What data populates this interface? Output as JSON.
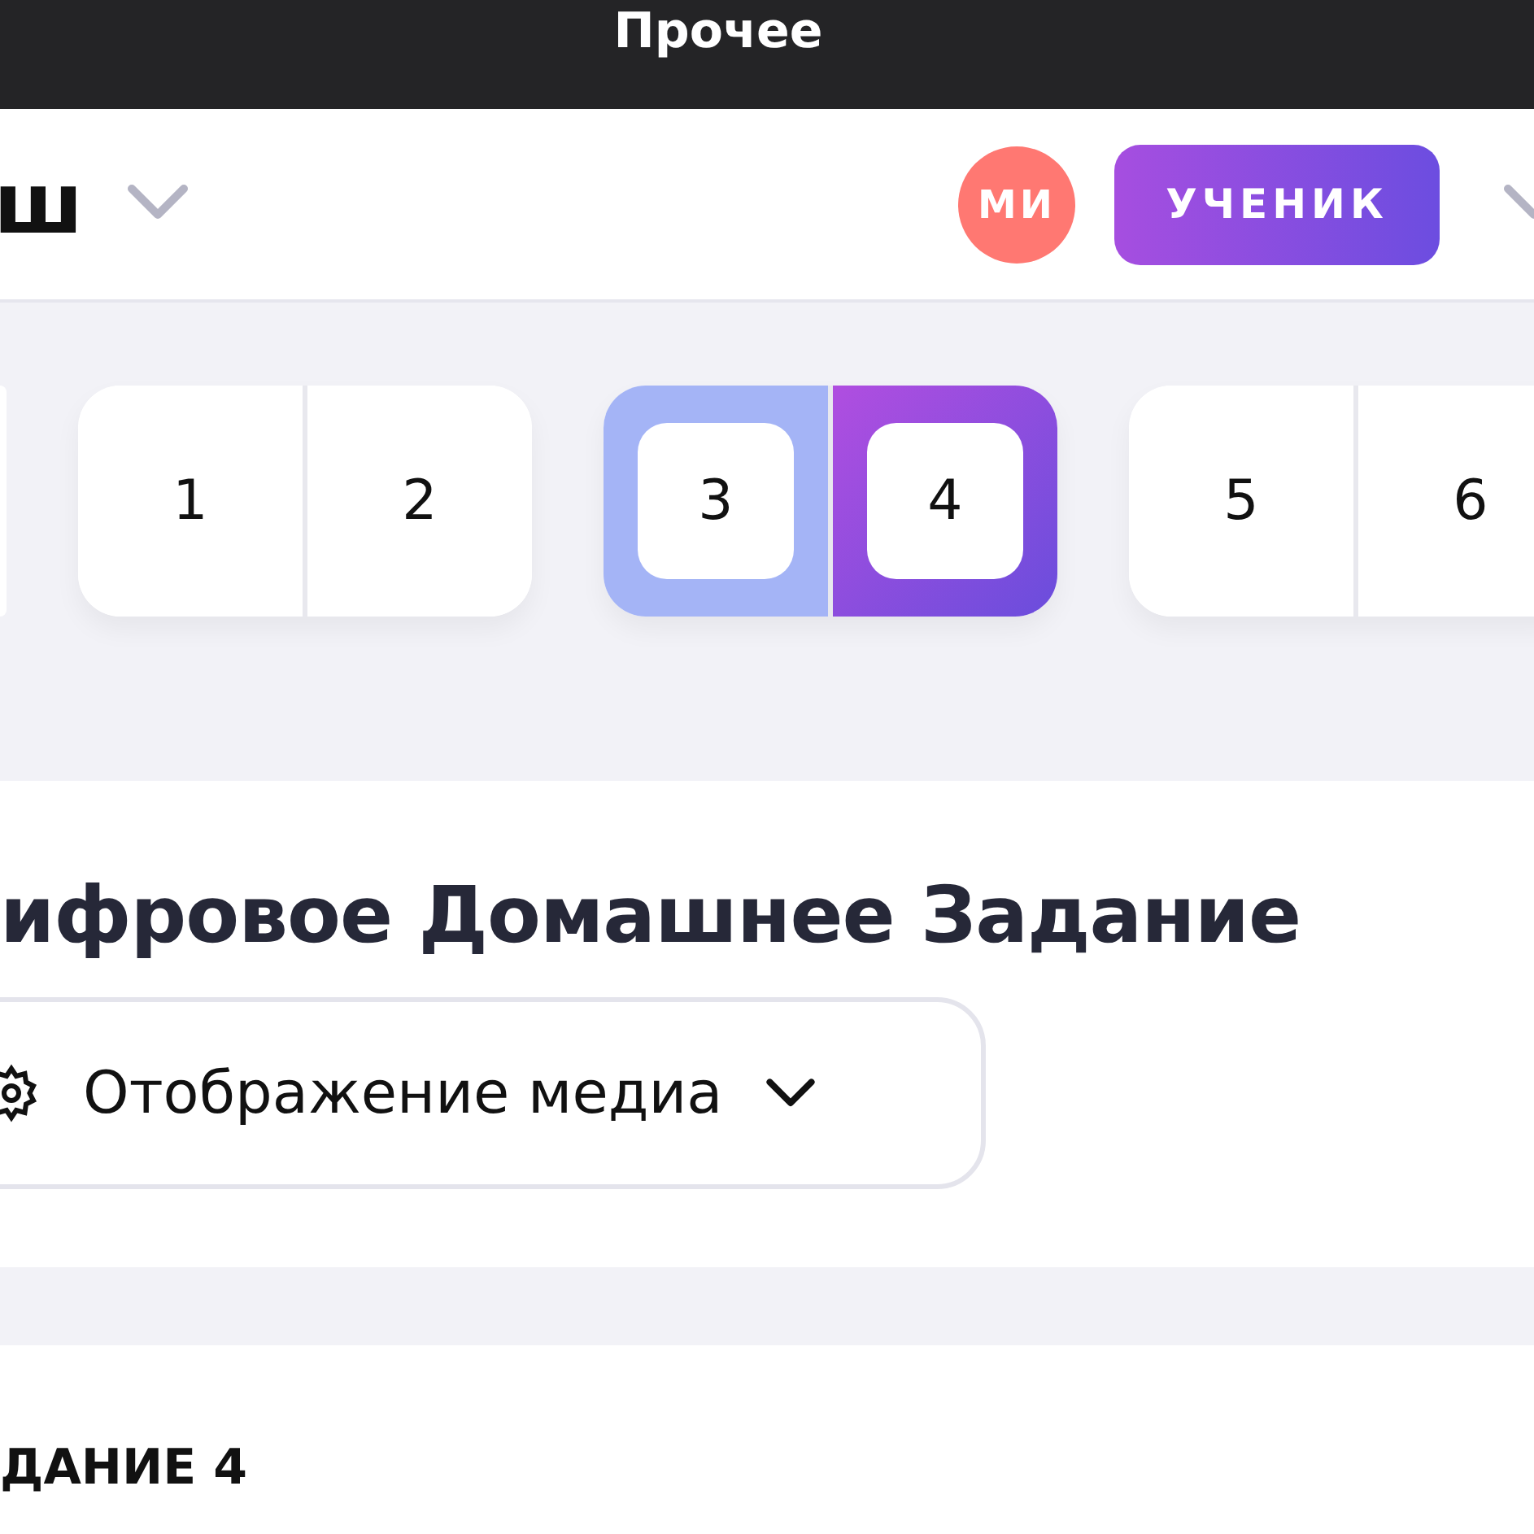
{
  "top_bar": {
    "title": "Прочее"
  },
  "header": {
    "logo_fragment": "ш",
    "avatar": "МИ",
    "role": "УЧЕНИК"
  },
  "page_groups": [
    {
      "active": false,
      "pages": [
        {
          "label": "1",
          "selected": false
        },
        {
          "label": "2",
          "selected": false
        }
      ]
    },
    {
      "active": true,
      "pages": [
        {
          "label": "3",
          "selected": false
        },
        {
          "label": "4",
          "selected": true
        }
      ]
    },
    {
      "active": false,
      "pages": [
        {
          "label": "5",
          "selected": false
        },
        {
          "label": "6",
          "selected": false
        }
      ]
    }
  ],
  "title": "ифровое Домашнее Задание",
  "media_button": {
    "label": "Отображение медиа"
  },
  "task": {
    "heading": "ДАНИЕ 4"
  }
}
